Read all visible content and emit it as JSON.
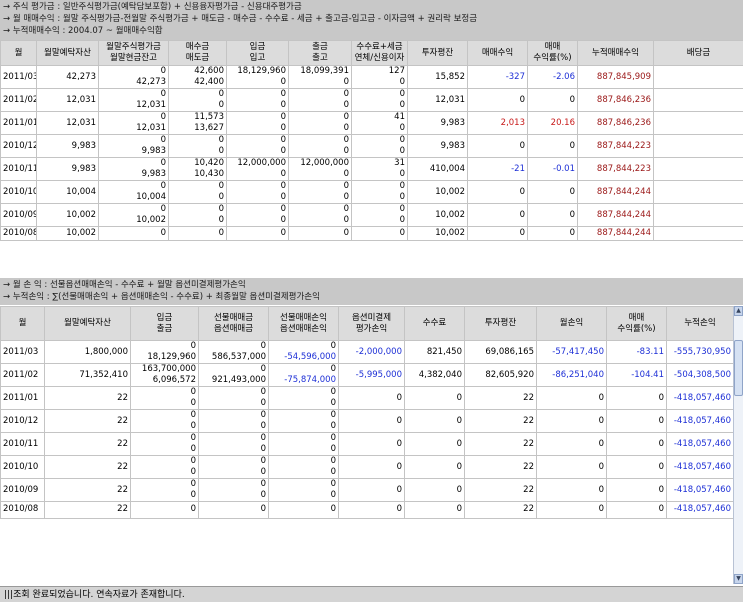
{
  "notes_top": [
    "→ 주식  평가금 : 일반주식평가금(예탁담보포함) + 신용융자평가금 - 신용대주평가금",
    "→ 월  매매수익 : 월말 주식평가금-전월말 주식평가금 + 매도금 - 매수금 - 수수료 - 세금 + 출고금-입고금 - 이자금액 + 권리락 보정금",
    "→ 누적매매수익 : 2004.07 ~ 월매매수익합"
  ],
  "table_top": {
    "headers": [
      [
        "월"
      ],
      [
        "월말예탁자산"
      ],
      [
        "월말주식평가금",
        "월말현금잔고"
      ],
      [
        "매수금",
        "매도금"
      ],
      [
        "입금",
        "입고"
      ],
      [
        "출금",
        "출고"
      ],
      [
        "수수료+세금",
        "연체/신용이자"
      ],
      [
        "투자평잔"
      ],
      [
        "매매수익"
      ],
      [
        "매매",
        "수익률(%)"
      ],
      [
        "누적매매수익"
      ],
      [
        "배당금"
      ]
    ],
    "rows": [
      {
        "month": "2011/03",
        "asset": "42,273",
        "stock": [
          "0",
          "42,273"
        ],
        "buysell": [
          "42,600",
          "42,400"
        ],
        "dep": [
          "18,129,960",
          "0"
        ],
        "wd": [
          "18,099,391",
          "0"
        ],
        "fee": [
          "127",
          "0"
        ],
        "avg": "15,852",
        "profit": "-327",
        "rate": "-2.06",
        "cum": "887,845,909"
      },
      {
        "month": "2011/02",
        "asset": "12,031",
        "stock": [
          "0",
          "12,031"
        ],
        "buysell": [
          "0",
          "0"
        ],
        "dep": [
          "0",
          "0"
        ],
        "wd": [
          "0",
          "0"
        ],
        "fee": [
          "0",
          "0"
        ],
        "avg": "12,031",
        "profit": "0",
        "rate": "0",
        "cum": "887,846,236"
      },
      {
        "month": "2011/01",
        "asset": "12,031",
        "stock": [
          "0",
          "12,031"
        ],
        "buysell": [
          "11,573",
          "13,627"
        ],
        "dep": [
          "0",
          "0"
        ],
        "wd": [
          "0",
          "0"
        ],
        "fee": [
          "41",
          "0"
        ],
        "avg": "9,983",
        "profit": "2,013",
        "rate": "20.16",
        "cum": "887,846,236"
      },
      {
        "month": "2010/12",
        "asset": "9,983",
        "stock": [
          "0",
          "9,983"
        ],
        "buysell": [
          "0",
          "0"
        ],
        "dep": [
          "0",
          "0"
        ],
        "wd": [
          "0",
          "0"
        ],
        "fee": [
          "0",
          "0"
        ],
        "avg": "9,983",
        "profit": "0",
        "rate": "0",
        "cum": "887,844,223"
      },
      {
        "month": "2010/11",
        "asset": "9,983",
        "stock": [
          "0",
          "9,983"
        ],
        "buysell": [
          "10,420",
          "10,430"
        ],
        "dep": [
          "12,000,000",
          "0"
        ],
        "wd": [
          "12,000,000",
          "0"
        ],
        "fee": [
          "31",
          "0"
        ],
        "avg": "410,004",
        "profit": "-21",
        "rate": "-0.01",
        "cum": "887,844,223"
      },
      {
        "month": "2010/10",
        "asset": "10,004",
        "stock": [
          "0",
          "10,004"
        ],
        "buysell": [
          "0",
          "0"
        ],
        "dep": [
          "0",
          "0"
        ],
        "wd": [
          "0",
          "0"
        ],
        "fee": [
          "0",
          "0"
        ],
        "avg": "10,002",
        "profit": "0",
        "rate": "0",
        "cum": "887,844,244"
      },
      {
        "month": "2010/09",
        "asset": "10,002",
        "stock": [
          "0",
          "10,002"
        ],
        "buysell": [
          "0",
          "0"
        ],
        "dep": [
          "0",
          "0"
        ],
        "wd": [
          "0",
          "0"
        ],
        "fee": [
          "0",
          "0"
        ],
        "avg": "10,002",
        "profit": "0",
        "rate": "0",
        "cum": "887,844,244"
      },
      {
        "month": "2010/08",
        "asset": "10,002",
        "stock": [
          "0"
        ],
        "buysell": [
          "0"
        ],
        "dep": [
          "0"
        ],
        "wd": [
          "0"
        ],
        "fee": [
          "0"
        ],
        "avg": "10,002",
        "profit": "0",
        "rate": "0",
        "cum": "887,844,244"
      }
    ]
  },
  "notes_mid": [
    "→ 월 손 익 : 선물옵션매매손익 - 수수료 + 월말 옵션미결제평가손익",
    "→ 누적손익 : ∑(선물매매손익 + 옵션매매손익 - 수수료) + 최종월말 옵션미결제평가손익"
  ],
  "table_bot": {
    "headers": [
      [
        "월"
      ],
      [
        "월말예탁자산"
      ],
      [
        "입금",
        "출금"
      ],
      [
        "선물매매금",
        "옵션매매금"
      ],
      [
        "선물매매손익",
        "옵션매매손익"
      ],
      [
        "옵션미결제",
        "평가손익"
      ],
      [
        "수수료"
      ],
      [
        "투자평잔"
      ],
      [
        "월손익"
      ],
      [
        "매매",
        "수익률(%)"
      ],
      [
        "누적손익"
      ]
    ],
    "rows": [
      {
        "month": "2011/03",
        "asset": "1,800,000",
        "io": [
          "0",
          "18,129,960"
        ],
        "trade": [
          "0",
          "586,537,000"
        ],
        "pl": [
          "0",
          "-54,596,000"
        ],
        "opt": "-2,000,000",
        "fee": "821,450",
        "avg": "69,086,165",
        "mpl": "-57,417,450",
        "rate": "-83.11",
        "cum": "-555,730,950"
      },
      {
        "month": "2011/02",
        "asset": "71,352,410",
        "io": [
          "163,700,000",
          "6,096,572"
        ],
        "trade": [
          "0",
          "921,493,000"
        ],
        "pl": [
          "0",
          "-75,874,000"
        ],
        "opt": "-5,995,000",
        "fee": "4,382,040",
        "avg": "82,605,920",
        "mpl": "-86,251,040",
        "rate": "-104.41",
        "cum": "-504,308,500"
      },
      {
        "month": "2011/01",
        "asset": "22",
        "io": [
          "0",
          "0"
        ],
        "trade": [
          "0",
          "0"
        ],
        "pl": [
          "0",
          "0"
        ],
        "opt": "0",
        "fee": "0",
        "avg": "22",
        "mpl": "0",
        "rate": "0",
        "cum": "-418,057,460"
      },
      {
        "month": "2010/12",
        "asset": "22",
        "io": [
          "0",
          "0"
        ],
        "trade": [
          "0",
          "0"
        ],
        "pl": [
          "0",
          "0"
        ],
        "opt": "0",
        "fee": "0",
        "avg": "22",
        "mpl": "0",
        "rate": "0",
        "cum": "-418,057,460"
      },
      {
        "month": "2010/11",
        "asset": "22",
        "io": [
          "0",
          "0"
        ],
        "trade": [
          "0",
          "0"
        ],
        "pl": [
          "0",
          "0"
        ],
        "opt": "0",
        "fee": "0",
        "avg": "22",
        "mpl": "0",
        "rate": "0",
        "cum": "-418,057,460"
      },
      {
        "month": "2010/10",
        "asset": "22",
        "io": [
          "0",
          "0"
        ],
        "trade": [
          "0",
          "0"
        ],
        "pl": [
          "0",
          "0"
        ],
        "opt": "0",
        "fee": "0",
        "avg": "22",
        "mpl": "0",
        "rate": "0",
        "cum": "-418,057,460"
      },
      {
        "month": "2010/09",
        "asset": "22",
        "io": [
          "0",
          "0"
        ],
        "trade": [
          "0",
          "0"
        ],
        "pl": [
          "0",
          "0"
        ],
        "opt": "0",
        "fee": "0",
        "avg": "22",
        "mpl": "0",
        "rate": "0",
        "cum": "-418,057,460"
      },
      {
        "month": "2010/08",
        "asset": "22",
        "io": [
          "0"
        ],
        "trade": [
          "0"
        ],
        "pl": [
          "0"
        ],
        "opt": "0",
        "fee": "0",
        "avg": "22",
        "mpl": "0",
        "rate": "0",
        "cum": "-418,057,460"
      }
    ]
  },
  "scrollbar": {
    "up_icon": "▲",
    "down_icon": "▼"
  },
  "status": {
    "text": "|||조회 완료되었습니다. 연속자료가 존재합니다."
  },
  "colors": {
    "negative": "#1d2fd6",
    "positive": "#c81a1a",
    "cumulative": "#9a1616",
    "header_bg": "#dcdcdc",
    "note_bg": "#c8c8c8"
  }
}
